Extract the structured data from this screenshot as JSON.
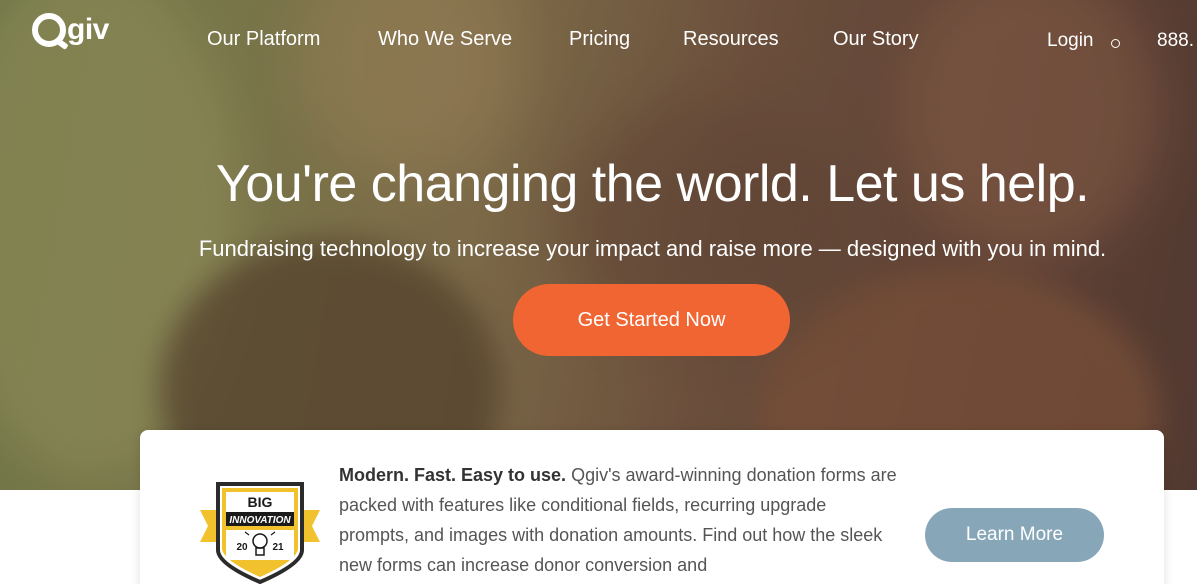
{
  "brand": {
    "name": "Qgiv"
  },
  "nav": {
    "items": [
      {
        "label": "Our Platform"
      },
      {
        "label": "Who We Serve"
      },
      {
        "label": "Pricing"
      },
      {
        "label": "Resources"
      },
      {
        "label": "Our Story"
      }
    ],
    "login": "Login",
    "phone": "888."
  },
  "hero": {
    "title": "You're changing the world. Let us help.",
    "subtitle": "Fundraising technology to increase your impact and raise more — designed with you in mind.",
    "cta": "Get Started Now"
  },
  "feature_card": {
    "lead": "Modern. Fast. Easy to use.",
    "body": " Qgiv's award-winning donation forms are packed with features like conditional fields, recurring upgrade prompts, and images with donation amounts. Find out how the sleek new forms can increase donor conversion and",
    "button": "Learn More",
    "badge": {
      "line1": "BIG",
      "line2": "INNOVATION",
      "year_left": "20",
      "year_right": "21"
    }
  },
  "colors": {
    "cta": "#f16532",
    "secondary_button": "#87a7b8",
    "badge_gold": "#f2c12e"
  }
}
